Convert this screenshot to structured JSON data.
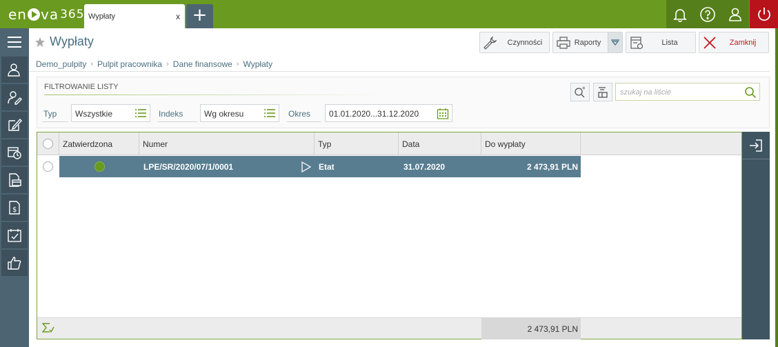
{
  "app": {
    "logo_text_a": "en",
    "logo_text_b": "va",
    "logo_num": "365"
  },
  "tabs": [
    {
      "label": "Wypłaty",
      "close": "x"
    }
  ],
  "add_tab": "+",
  "topbar_icons": [
    "bell-icon",
    "help-icon",
    "user-icon",
    "power-icon"
  ],
  "sidebar": {
    "menu_icon": "hamburger-icon",
    "items": [
      "employee-icon",
      "employee-edit-icon",
      "edit-icon",
      "calendar-clock-icon",
      "briefcase-icon",
      "payslip-icon",
      "calendar-check-icon",
      "thumbs-up-icon"
    ]
  },
  "header": {
    "title": "Wypłaty"
  },
  "toolbar": {
    "actions": "Czynności",
    "reports": "Raporty",
    "list": "Lista",
    "close": "Zamknij"
  },
  "breadcrumb": [
    "Demo_pulpity",
    "Pulpit pracownika",
    "Dane finansowe",
    "Wypłaty"
  ],
  "filter": {
    "title": "FILTROWANIE LISTY",
    "type_label": "Typ",
    "type_value": "Wszystkie",
    "index_label": "Indeks",
    "index_value": "Wg okresu",
    "period_label": "Okres",
    "period_value": "01.01.2020...31.12.2020",
    "search_placeholder": "szukaj na liście"
  },
  "grid": {
    "columns": [
      "Zatwierdzona",
      "Numer",
      "Typ",
      "Data",
      "Do wypłaty"
    ],
    "rows": [
      {
        "approved": true,
        "number": "LPE/SR/2020/07/1/0001",
        "type": "Etat",
        "date": "31.07.2020",
        "amount": "2 473,91 PLN"
      }
    ],
    "sum": "2 473,91 PLN"
  },
  "colors": {
    "brand_green": "#6a9a1f",
    "sidebar": "#4d6472",
    "selected_row": "#587d90",
    "power": "#b8121b"
  }
}
